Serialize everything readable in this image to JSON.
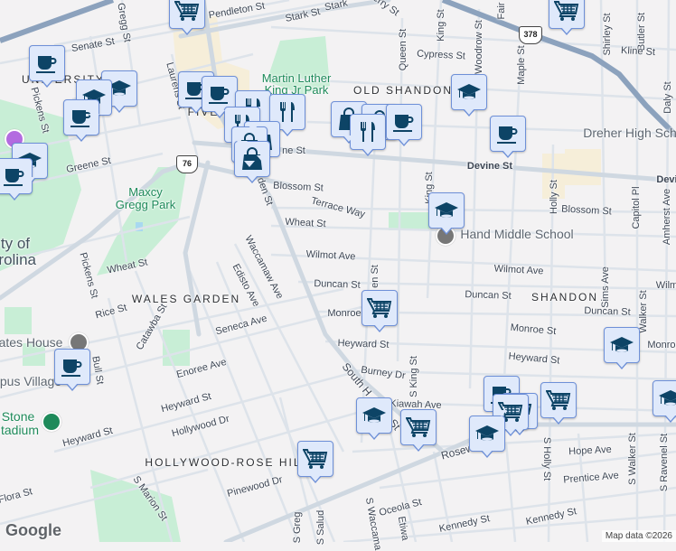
{
  "map": {
    "streets": {
      "pendleton": "Pendleton St",
      "stark": "Stark St",
      "stark2": "Stark",
      "senate": "Senate St",
      "gregg": "Gregg St",
      "laurens": "Laurens St",
      "pickens": "Pickens St",
      "pickens2": "Pickens St",
      "greene": "Greene St",
      "devine_w": "ne St",
      "devine": "Devine St",
      "devine_e": "Devi",
      "blossom_w": "Blossom St",
      "blossom_e": "Blossom St",
      "harden": "den St",
      "terrace": "Terrace Way",
      "wheat": "Wheat St",
      "wheat_w": "Wheat St",
      "wilmot": "Wilmot Ave",
      "wilmot_e": "Wilmot Ave",
      "wilm": "Wilm",
      "waccamaw": "Waccamaw Ave",
      "edisto": "Edisto Ave",
      "cypress": "Cypress St",
      "queen": "Queen St",
      "queen2": "en St",
      "king": "King St",
      "king2": "King St",
      "woodrow": "Woodrow St",
      "fair": "Fair",
      "perry": "erry St",
      "maple": "Maple St",
      "shirley": "Shirley St",
      "butler": "Butler St",
      "kline": "Kline St",
      "daly": "Daly St",
      "holly": "Holly St",
      "capitol": "Capitol Pl",
      "amherst": "Amherst Ave",
      "rice": "Rice St",
      "catawba": "Catawba St",
      "seneca": "Seneca Ave",
      "enoree": "Enoree Ave",
      "bull": "Bull St",
      "heyward1": "Heyward St",
      "heyward2": "Heyward St",
      "heyward3": "Heyward St",
      "heyward4": "Heyward St",
      "hollywood": "Hollywood Dr",
      "pinewood": "Pinewood Dr",
      "marion": "S Marion St",
      "flora": "Flora St",
      "sgregg": "S Greg",
      "saluda": "S Salud",
      "duncan1": "Duncan St",
      "duncan2": "Duncan St",
      "duncan3": "Duncan St",
      "monroe1": "Monroe",
      "monroe2": "Monroe St",
      "monroe3": "Monroe",
      "burney": "Burney Dr",
      "southharden": "South H",
      "southharden2": "St",
      "sking": "S King St",
      "kiawah": "Kiawah Ave",
      "rosewood": "Rosew",
      "hope": "Hope Ave",
      "prentice": "Prentice Ave",
      "sholly": "S Holly St",
      "swalker": "S Walker St",
      "sravenel": "S Ravenel St",
      "swaccamaw": "S Waccama",
      "etiwan": "Etiwa",
      "oceola": "Oceola St",
      "kennedy1": "Kennedy St",
      "kennedy2": "Kennedy St",
      "sims": "Sims Ave",
      "walker": "Walker St"
    },
    "neighborhoods": {
      "university": "UNIVERSITY",
      "five": "FIVE",
      "old_shandon": "OLD SHANDON",
      "wales_garden": "WALES GARDEN",
      "shandon": "SHANDON",
      "hollywood_rose_hill": "HOLLYWOOD-ROSE HIL"
    },
    "places": {
      "mlk_park_1": "Martin Luther",
      "mlk_park_2": "King Jr Park",
      "maxcy_1": "Maxcy",
      "maxcy_2": "Gregg Park",
      "usc_1": "ty of",
      "usc_2": "rolina",
      "dreher": "Dreher High Sch",
      "hand": "Hand Middle School",
      "gates": "ates House",
      "campus_village": "pus Village",
      "stone_1": "Stone",
      "stone_2": "tadium"
    },
    "shields": {
      "us76": "76",
      "us378": "378"
    },
    "attribution": "Map data ©2026",
    "logo": "Google",
    "markers": [
      "cart",
      "coffee",
      "school",
      "school",
      "coffee",
      "coffee",
      "coffee",
      "restaurant",
      "restaurant",
      "restaurant",
      "shopping",
      "shopping",
      "shopping",
      "school",
      "coffee",
      "coffee",
      "shopping",
      "shopping",
      "restaurant",
      "coffee",
      "school",
      "coffee",
      "cart",
      "school",
      "cart",
      "school",
      "coffee",
      "cart",
      "cart",
      "cart",
      "school",
      "school",
      "cart",
      "school",
      "cart"
    ],
    "colors": {
      "marker_bg": "#dfe9fb",
      "marker_border": "#6e90d8",
      "icon": "#0d4466",
      "park": "#c4ecd3",
      "highway": "#8ca2bd"
    }
  }
}
